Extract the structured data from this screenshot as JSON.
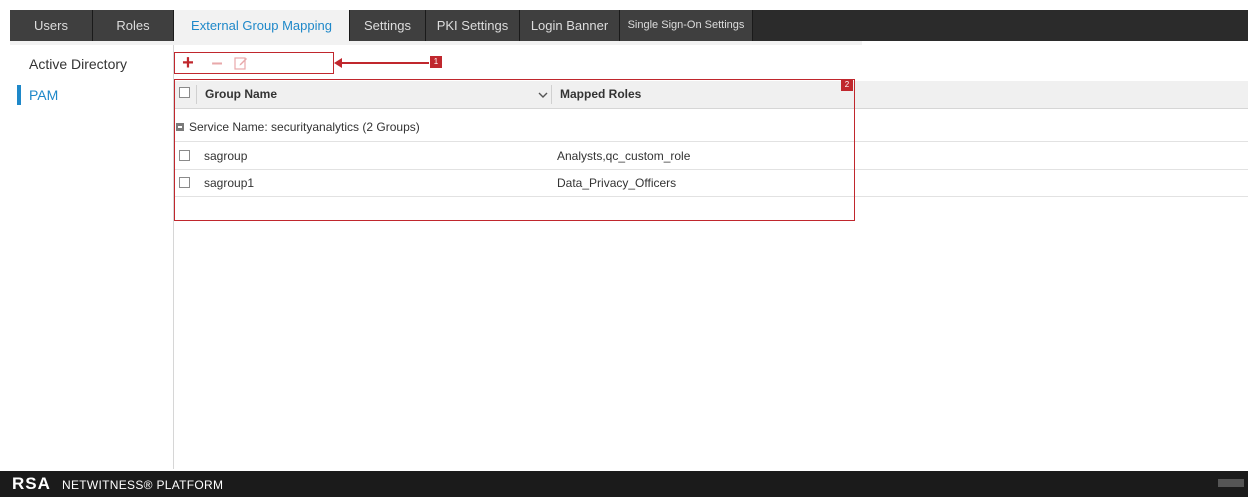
{
  "tabs": [
    {
      "label": "Users",
      "active": false
    },
    {
      "label": "Roles",
      "active": false
    },
    {
      "label": "External Group Mapping",
      "active": true
    },
    {
      "label": "Settings",
      "active": false
    },
    {
      "label": "PKI Settings",
      "active": false
    },
    {
      "label": "Login Banner",
      "active": false
    },
    {
      "label": "Single Sign-On Settings",
      "active": false
    }
  ],
  "sidebar": {
    "items": [
      {
        "label": "Active Directory",
        "selected": false
      },
      {
        "label": "PAM",
        "selected": true
      }
    ]
  },
  "toolbar": {
    "add_icon": "plus-icon",
    "remove_icon": "minus-icon",
    "edit_icon": "edit-icon"
  },
  "callouts": [
    "1",
    "2"
  ],
  "grid": {
    "columns": [
      "Group Name",
      "Mapped Roles"
    ],
    "group_label": "Service Name: securityanalytics (2 Groups)",
    "rows": [
      {
        "group_name": "sagroup",
        "mapped_roles": "Analysts,qc_custom_role"
      },
      {
        "group_name": "sagroup1",
        "mapped_roles": "Data_Privacy_Officers"
      }
    ]
  },
  "footer": {
    "logo": "RSA",
    "platform": "NETWITNESS® PLATFORM"
  },
  "colors": {
    "accent": "#1e88c9",
    "callout": "#c0272d",
    "tabbar": "#2b2b2b",
    "footer": "#1b1b1b"
  }
}
